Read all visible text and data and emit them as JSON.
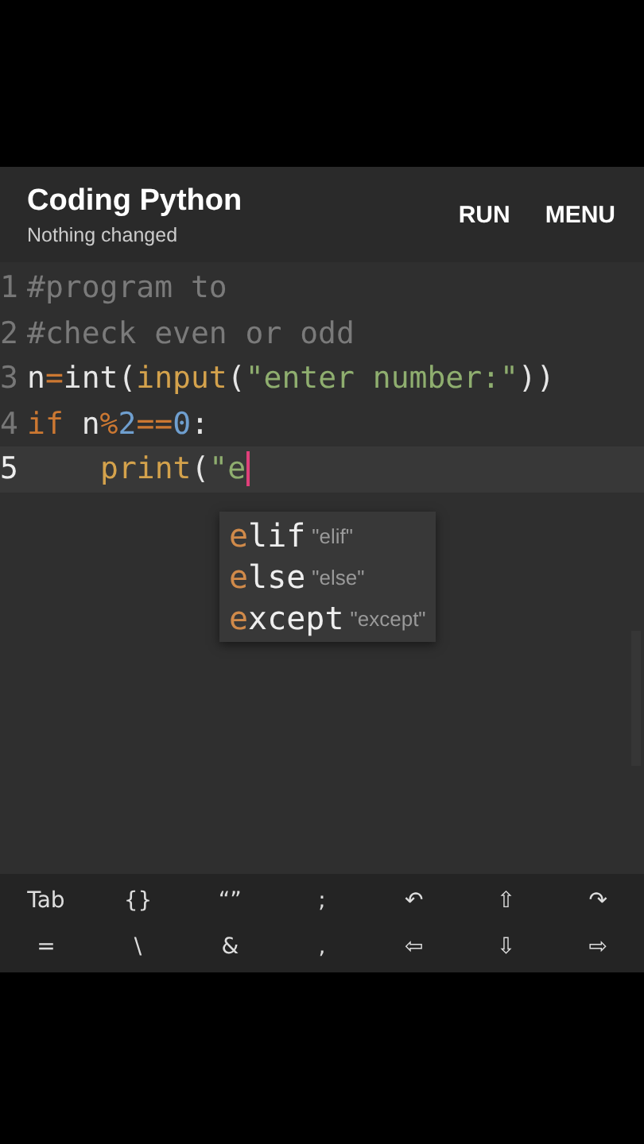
{
  "app_bar": {
    "title": "Coding Python",
    "subtitle": "Nothing changed",
    "actions": [
      "RUN",
      "MENU"
    ]
  },
  "editor": {
    "lines": [
      {
        "number": "1",
        "selected": false,
        "indented": false,
        "tokens": [
          {
            "kind": "comment",
            "text": "#program to"
          }
        ]
      },
      {
        "number": "2",
        "selected": false,
        "indented": false,
        "tokens": [
          {
            "kind": "comment",
            "text": "#check even or odd"
          }
        ]
      },
      {
        "number": "3",
        "selected": false,
        "indented": false,
        "tokens": [
          {
            "kind": "name",
            "text": "n"
          },
          {
            "kind": "operator",
            "text": "="
          },
          {
            "kind": "name",
            "text": "int("
          },
          {
            "kind": "builtin",
            "text": "input"
          },
          {
            "kind": "name",
            "text": "("
          },
          {
            "kind": "string",
            "text": "\"enter number:\""
          },
          {
            "kind": "name",
            "text": "))"
          }
        ]
      },
      {
        "number": "4",
        "selected": false,
        "indented": false,
        "tokens": [
          {
            "kind": "keyword",
            "text": "if"
          },
          {
            "kind": "name",
            "text": " n"
          },
          {
            "kind": "operator",
            "text": "%"
          },
          {
            "kind": "number",
            "text": "2"
          },
          {
            "kind": "operator",
            "text": "=="
          },
          {
            "kind": "number",
            "text": "0"
          },
          {
            "kind": "name",
            "text": ":"
          }
        ]
      },
      {
        "number": "5",
        "selected": true,
        "indented": true,
        "tokens": [
          {
            "kind": "builtin",
            "text": "print"
          },
          {
            "kind": "name",
            "text": "("
          },
          {
            "kind": "string",
            "text": "\"e"
          }
        ]
      }
    ],
    "suggestions": [
      {
        "match": "e",
        "rest": "lif",
        "hint": "\"elif\""
      },
      {
        "match": "e",
        "rest": "lse",
        "hint": "\"else\""
      },
      {
        "match": "e",
        "rest": "xcept",
        "hint": "\"except\""
      }
    ]
  },
  "key_bar": {
    "rows": [
      [
        "Tab",
        "{}",
        "“”",
        ";",
        "↶",
        "⇧",
        "↷"
      ],
      [
        "=",
        "\\",
        "&",
        ",",
        "⇦",
        "⇩",
        "⇨"
      ]
    ]
  }
}
